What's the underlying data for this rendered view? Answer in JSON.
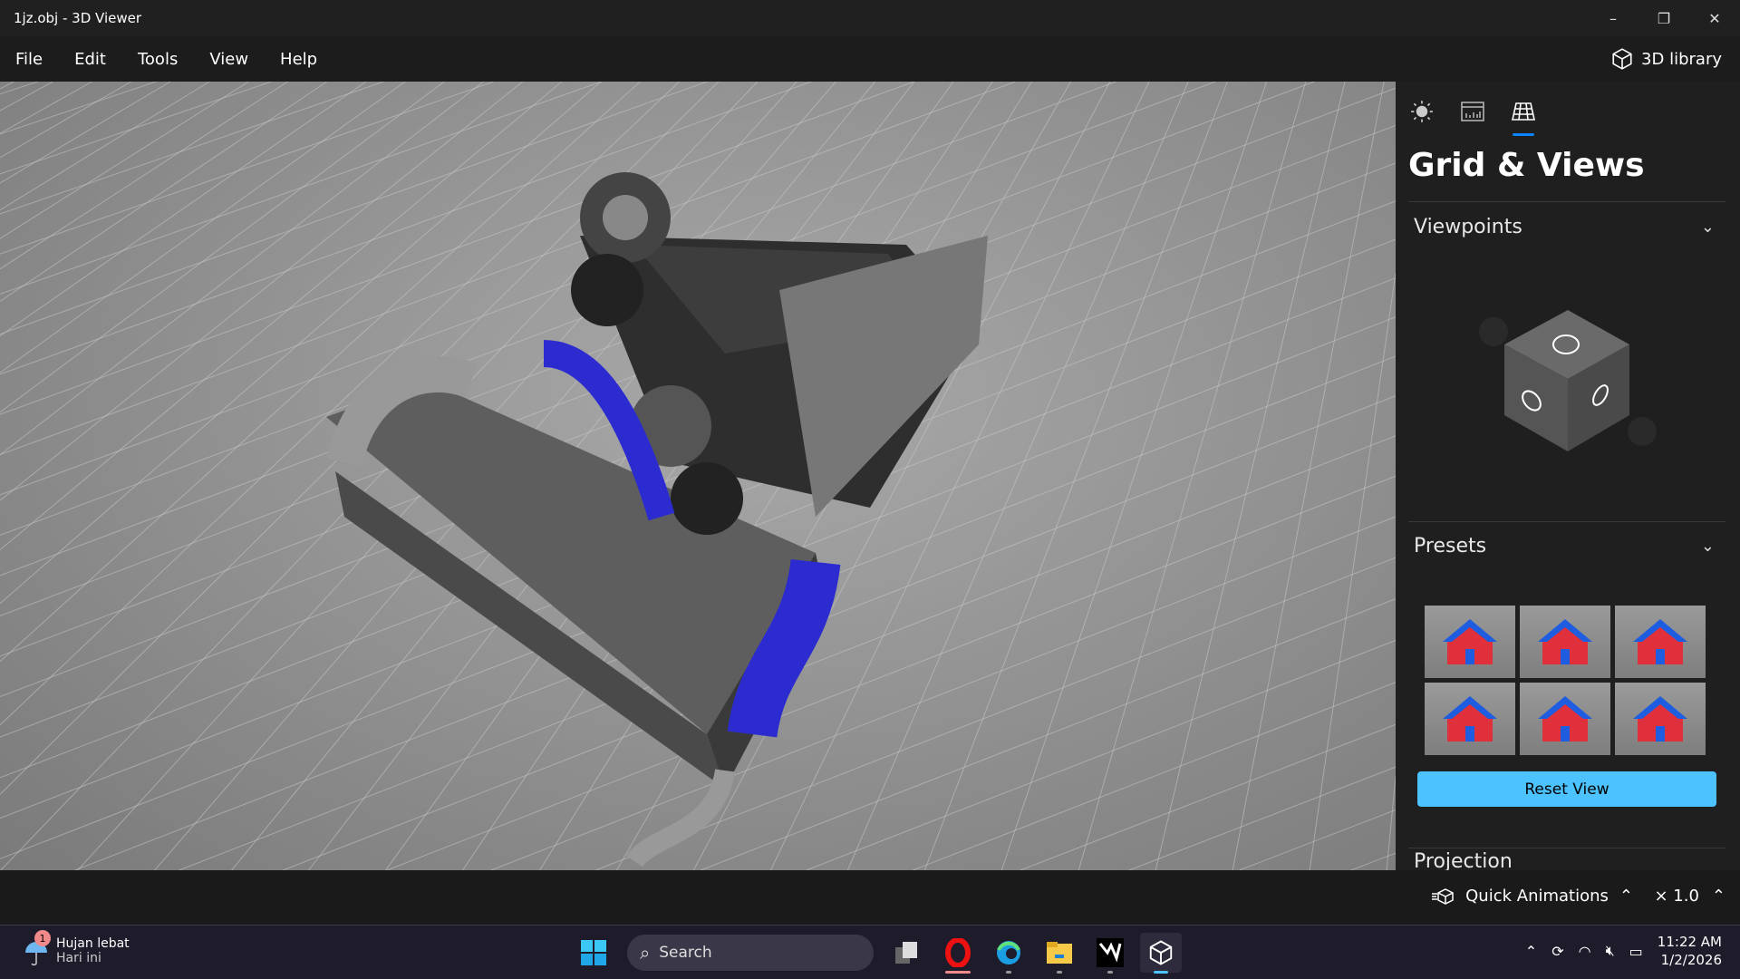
{
  "window": {
    "title": "1jz.obj - 3D Viewer",
    "minimize": "–",
    "restore": "❐",
    "close": "✕"
  },
  "menu": {
    "items": [
      "File",
      "Edit",
      "Tools",
      "View",
      "Help"
    ],
    "library": "3D library"
  },
  "panel": {
    "tabs": [
      {
        "icon": "lighting-icon"
      },
      {
        "icon": "stats-icon"
      },
      {
        "icon": "grid-icon",
        "active": true
      }
    ],
    "title": "Grid & Views",
    "sections": {
      "viewpoints": "Viewpoints",
      "presets": "Presets",
      "projection": "Projection"
    },
    "reset_label": "Reset View",
    "accent": "#4cc2ff"
  },
  "bottom": {
    "quick_animations": "Quick Animations",
    "speed": "× 1.0"
  },
  "taskbar": {
    "weather": {
      "title": "Hujan lebat",
      "subtitle": "Hari ini",
      "badge": "1"
    },
    "search_placeholder": "Search",
    "time": "11:22 AM",
    "date": "1/2/2026"
  }
}
